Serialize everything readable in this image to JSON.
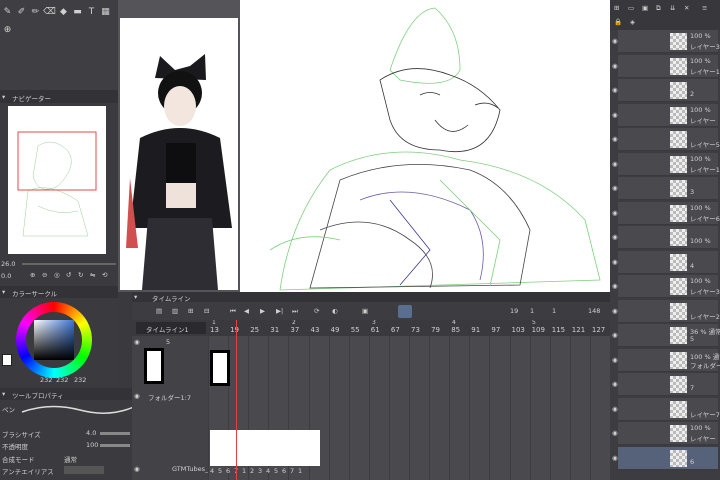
{
  "app": {
    "accent": "#e6474a",
    "playhead_color": "#e34141"
  },
  "navigator": {
    "title": "ナビゲーター",
    "zoom": "26.0",
    "rotate": "0.0"
  },
  "color_circle": {
    "title": "カラーサークル",
    "values": [
      "232",
      "232",
      "232"
    ]
  },
  "tool_property": {
    "title": "ツールプロパティ",
    "tool_name": "ペン",
    "brush_size_label": "ブラシサイズ",
    "brush_size_value": "4.0",
    "opacity_label": "不透明度",
    "opacity_value": "100",
    "blend_label": "合成モード",
    "blend_value": "通常",
    "antialias_label": "アンチエイリアス"
  },
  "timeline": {
    "title": "タイムライン",
    "name": "タイムライン1",
    "current_frame": "19",
    "fields": [
      "1",
      "1",
      "148"
    ],
    "ruler_top": [
      "1",
      "2",
      "3",
      "4",
      "5"
    ],
    "ruler": [
      "13",
      "19",
      "25",
      "31",
      "37",
      "43",
      "49",
      "55",
      "61",
      "67",
      "73",
      "79",
      "85",
      "91",
      "97",
      "103",
      "109",
      "115",
      "121",
      "127"
    ],
    "tracks": [
      {
        "name": "5"
      },
      {
        "name": "フォルダー1:7"
      },
      {
        "name": "GTMTubes_ori"
      }
    ],
    "folder_numbers_a": [
      "1",
      "2",
      "3"
    ],
    "folder_numbers_b": [
      "4",
      "5",
      "6",
      "7",
      "1",
      "2",
      "3",
      "4",
      "5",
      "6",
      "7",
      "1"
    ]
  },
  "layers": {
    "rows": [
      {
        "pct": "100 %",
        "name": "レイヤー3"
      },
      {
        "pct": "100 %",
        "name": "レイヤー1"
      },
      {
        "pct": "",
        "name": "2"
      },
      {
        "pct": "100 %",
        "name": "レイヤー"
      },
      {
        "pct": "",
        "name": "レイヤー5"
      },
      {
        "pct": "100 %",
        "name": "レイヤー1"
      },
      {
        "pct": "",
        "name": "3"
      },
      {
        "pct": "100 %",
        "name": "レイヤー6"
      },
      {
        "pct": "",
        "name": "100 %"
      },
      {
        "pct": "",
        "name": "4"
      },
      {
        "pct": "100 %",
        "name": "レイヤー3"
      },
      {
        "pct": "",
        "name": "レイヤー2"
      },
      {
        "pct": "36 % 通常",
        "name": "5"
      },
      {
        "pct": "100 % 通常",
        "name": "フォルダー1:7"
      },
      {
        "pct": "",
        "name": "7"
      },
      {
        "pct": "",
        "name": "レイヤー7"
      },
      {
        "pct": "100 %",
        "name": "レイヤー"
      },
      {
        "pct": "",
        "name": "6"
      }
    ]
  }
}
